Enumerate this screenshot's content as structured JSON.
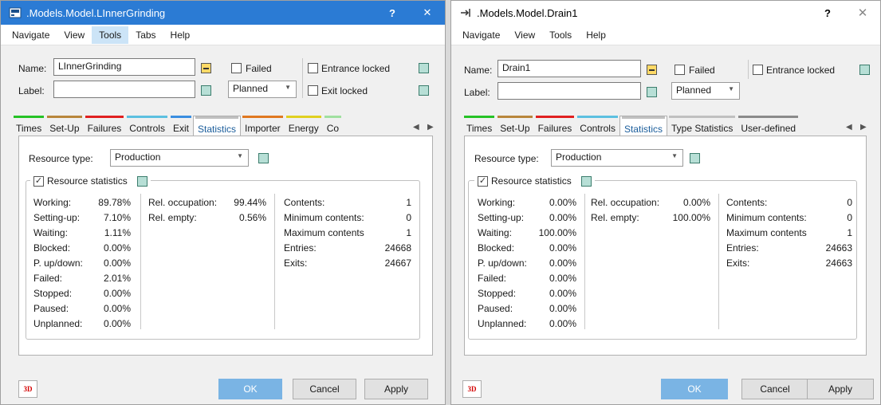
{
  "colors": {
    "title_active": "#2b7bd4",
    "teal_swatch": "#b7dfd6",
    "primary_button": "#7ab4e4",
    "tab_bars": [
      "#26c226",
      "#b8863b",
      "#e02020",
      "#5cc0e0",
      "#3a8ee0",
      "#c0c0c0",
      "#e07820",
      "#e0d020",
      "#a0e0a0"
    ]
  },
  "left": {
    "title": ".Models.Model.LInnerGrinding",
    "help_btn": "?",
    "close_btn": "✕",
    "menu": [
      "Navigate",
      "View",
      "Tools",
      "Tabs",
      "Help"
    ],
    "active_menu": "Tools",
    "name_label": "Name:",
    "name_value": "LInnerGrinding",
    "label_label": "Label:",
    "label_value": "",
    "failed_label": "Failed",
    "planned_value": "Planned",
    "entrance_label": "Entrance locked",
    "exit_label": "Exit locked",
    "tabs": [
      "Times",
      "Set-Up",
      "Failures",
      "Controls",
      "Exit",
      "Statistics",
      "Importer",
      "Energy",
      "Co"
    ],
    "active_tab": "Statistics",
    "resource_type_label": "Resource type:",
    "resource_type_value": "Production",
    "group_title": "Resource statistics",
    "col1": [
      {
        "k": "Working:",
        "v": "89.78%"
      },
      {
        "k": "Setting-up:",
        "v": "7.10%"
      },
      {
        "k": "Waiting:",
        "v": "1.11%"
      },
      {
        "k": "Blocked:",
        "v": "0.00%"
      },
      {
        "k": "P. up/down:",
        "v": "0.00%"
      },
      {
        "k": "Failed:",
        "v": "2.01%"
      },
      {
        "k": "Stopped:",
        "v": "0.00%"
      },
      {
        "k": "Paused:",
        "v": "0.00%"
      },
      {
        "k": "Unplanned:",
        "v": "0.00%"
      }
    ],
    "col2": [
      {
        "k": "Rel. occupation:",
        "v": "99.44%"
      },
      {
        "k": "Rel. empty:",
        "v": "0.56%"
      }
    ],
    "col3": [
      {
        "k": "Contents:",
        "v": "1"
      },
      {
        "k": "Minimum contents:",
        "v": "0"
      },
      {
        "k": "Maximum contents",
        "v": "1"
      },
      {
        "k": "Entries:",
        "v": "24668"
      },
      {
        "k": "Exits:",
        "v": "24667"
      }
    ],
    "btn_3d": "3D",
    "ok": "OK",
    "cancel": "Cancel",
    "apply": "Apply"
  },
  "right": {
    "title": ".Models.Model.Drain1",
    "help_btn": "?",
    "close_btn": "✕",
    "menu": [
      "Navigate",
      "View",
      "Tools",
      "Help"
    ],
    "name_label": "Name:",
    "name_value": "Drain1",
    "label_label": "Label:",
    "label_value": "",
    "failed_label": "Failed",
    "planned_value": "Planned",
    "entrance_label": "Entrance locked",
    "tabs": [
      "Times",
      "Set-Up",
      "Failures",
      "Controls",
      "Statistics",
      "Type Statistics",
      "User-defined"
    ],
    "active_tab": "Statistics",
    "resource_type_label": "Resource type:",
    "resource_type_value": "Production",
    "group_title": "Resource statistics",
    "col1": [
      {
        "k": "Working:",
        "v": "0.00%"
      },
      {
        "k": "Setting-up:",
        "v": "0.00%"
      },
      {
        "k": "Waiting:",
        "v": "100.00%"
      },
      {
        "k": "Blocked:",
        "v": "0.00%"
      },
      {
        "k": "P. up/down:",
        "v": "0.00%"
      },
      {
        "k": "Failed:",
        "v": "0.00%"
      },
      {
        "k": "Stopped:",
        "v": "0.00%"
      },
      {
        "k": "Paused:",
        "v": "0.00%"
      },
      {
        "k": "Unplanned:",
        "v": "0.00%"
      }
    ],
    "col2": [
      {
        "k": "Rel. occupation:",
        "v": "0.00%"
      },
      {
        "k": "Rel. empty:",
        "v": "100.00%"
      }
    ],
    "col3": [
      {
        "k": "Contents:",
        "v": "0"
      },
      {
        "k": "Minimum contents:",
        "v": "0"
      },
      {
        "k": "Maximum contents",
        "v": "1"
      },
      {
        "k": "Entries:",
        "v": "24663"
      },
      {
        "k": "Exits:",
        "v": "24663"
      }
    ],
    "btn_3d": "3D",
    "ok": "OK",
    "cancel": "Cancel",
    "apply": "Apply"
  }
}
